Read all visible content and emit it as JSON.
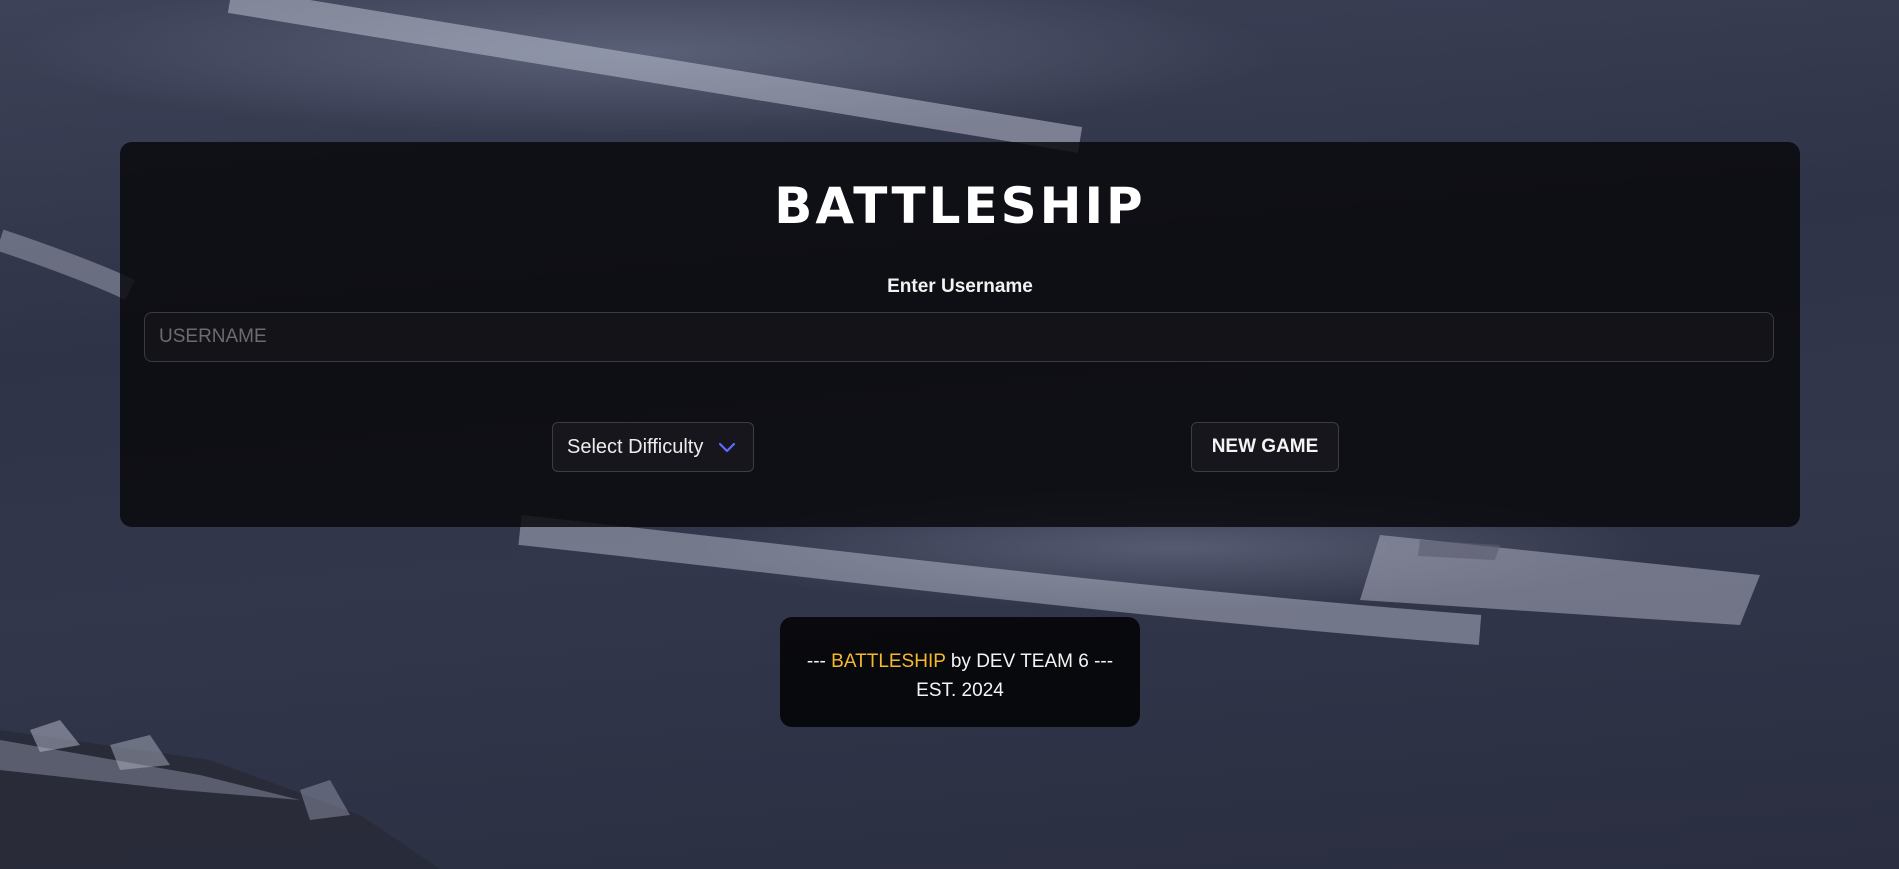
{
  "app": {
    "title": "BATTLESHIP"
  },
  "form": {
    "username_label": "Enter Username",
    "username_placeholder": "USERNAME",
    "username_value": "",
    "difficulty_label": "Select Difficulty",
    "new_game_label": "NEW GAME"
  },
  "footer": {
    "prefix": "---",
    "brand": "BATTLESHIP",
    "byline": "by DEV TEAM 6 ---",
    "established": "EST. 2024"
  },
  "colors": {
    "brand_accent": "#f5b82e",
    "chevron": "#5b6cff",
    "panel_bg": "#08080c"
  },
  "icons": {
    "difficulty_chevron": "chevron-down-icon"
  }
}
